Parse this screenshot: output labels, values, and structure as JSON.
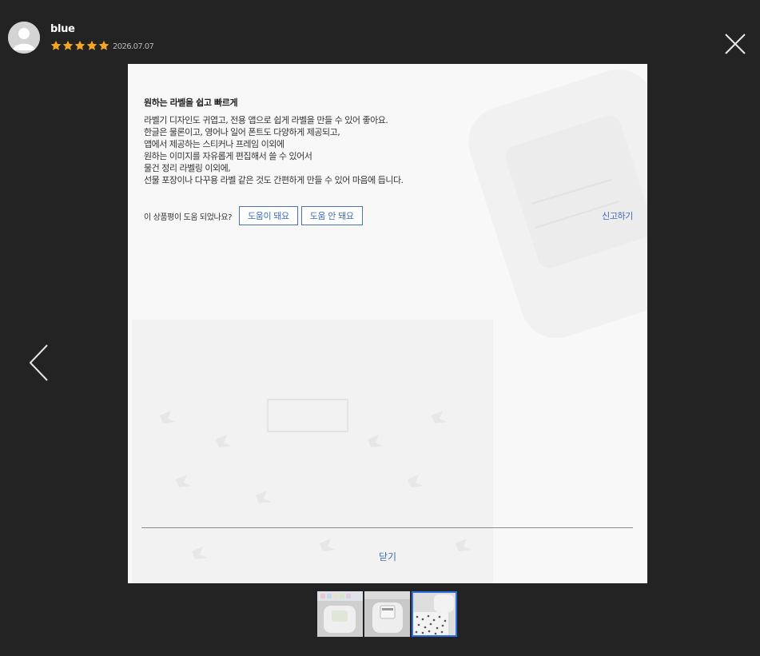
{
  "reviewer": {
    "name": "blue",
    "rating": 5,
    "max_rating": 5,
    "date": "2026.07.07"
  },
  "review": {
    "title": "원하는 라벨을 쉽고 빠르게",
    "body_lines": [
      "라벨기 디자인도 귀엽고, 전용 앱으로 쉽게 라벨을 만들 수 있어 좋아요.",
      "한글은 물론이고, 영어나 일어 폰트도 다양하게 제공되고,",
      "앱에서 제공하는 스티커나 프레임 이외에",
      "원하는 이미지를 자유롭게 편집해서 쓸 수 있어서",
      "물건 정리 라벨링 이외에,",
      "선물 포장이나 다꾸용 라벨 같은 것도 간편하게 만들 수 있어 마음에 듭니다."
    ]
  },
  "helpful": {
    "question": "이 상품평이 도움 되었나요?",
    "yes_label": "도움이 돼요",
    "no_label": "도움 안 돼요"
  },
  "report_label": "신고하기",
  "close_label": "닫기",
  "thumbnails": {
    "count": 3,
    "active_index": 2
  },
  "colors": {
    "background": "#232323",
    "accent": "#3d6bb3",
    "star": "#f5a623",
    "active_thumb_border": "#2f6fe0"
  },
  "icons": {
    "close": "close-icon",
    "prev": "chevron-left-icon",
    "avatar": "user-avatar-icon",
    "star": "star-icon"
  }
}
